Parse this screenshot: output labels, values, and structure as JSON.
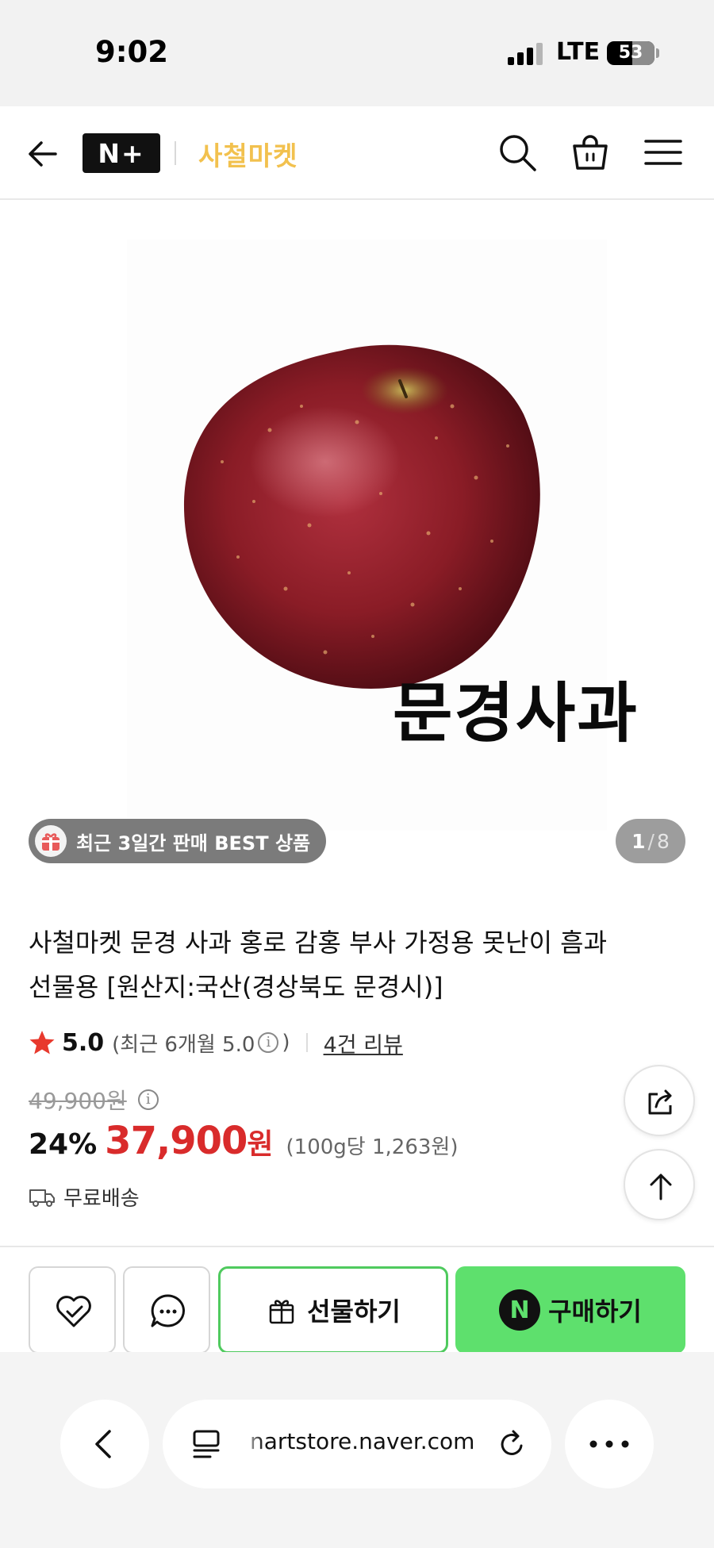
{
  "status_bar": {
    "time": "9:02",
    "network": "LTE",
    "battery": "53",
    "battery_level": 0.53
  },
  "header": {
    "logo_text": "N+",
    "store_name": "사철마켓",
    "icons": [
      "arrow-left-icon",
      "search-icon",
      "shopping-bag-icon",
      "menu-icon"
    ]
  },
  "gallery": {
    "image_caption": "문경사과",
    "badge": "최근 3일간 판매 BEST 상품",
    "current_page": "1",
    "separator": "/",
    "total_pages": "8"
  },
  "product": {
    "title_line1": "사철마켓 문경 사과 홍로 감홍 부사 가정용 못난이 흠과",
    "title_line2": "선물용 [원산지:국산(경상북도 문경시)]",
    "rating": "5.0",
    "rating_note": "(최근 6개월 5.0",
    "rating_note_close": ")",
    "info_glyph": "i",
    "review_count": "4건 리뷰",
    "original_price": "49,900원",
    "discount_rate": "24%",
    "sale_price": "37,900",
    "currency": "원",
    "unit_price": "(100g당 1,263원)",
    "shipping": "무료배송"
  },
  "actions": {
    "gift_label": "선물하기",
    "buy_label": "구매하기",
    "npay_glyph": "N"
  },
  "browser": {
    "url": "nartstore.naver.com"
  },
  "colors": {
    "accent_green": "#5ee06d",
    "gift_border": "#4fca5e",
    "sale_red": "#d92b2b",
    "store_yellow": "#f2c14e",
    "star_red": "#e8392d"
  }
}
